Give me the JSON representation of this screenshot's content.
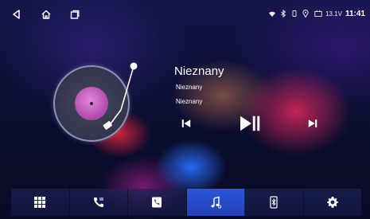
{
  "status_bar": {
    "nav": [
      {
        "name": "back-icon"
      },
      {
        "name": "home-icon"
      },
      {
        "name": "recent-apps-icon"
      }
    ],
    "icons": [
      "wifi-icon",
      "bluetooth-icon",
      "location-icon",
      "battery-icon"
    ],
    "voltage": "13.1V",
    "time": "11:41"
  },
  "player": {
    "title": "Nieznany",
    "artist": "Nieznany",
    "album": "Nieznany",
    "controls": [
      "previous-icon",
      "play-pause-icon",
      "next-icon"
    ]
  },
  "dock": {
    "items": [
      {
        "name": "apps-grid-icon"
      },
      {
        "name": "phone-icon"
      },
      {
        "name": "contacts-icon"
      },
      {
        "name": "music-icon",
        "active": true
      },
      {
        "name": "bluetooth-phone-icon"
      },
      {
        "name": "settings-gear-icon"
      }
    ],
    "active_color": "#2b56d8"
  },
  "colors": {
    "background": "#0c0f33",
    "vinyl_label": "#b650b0",
    "accent_red": "#e2285c",
    "accent_blue": "#286eff"
  }
}
